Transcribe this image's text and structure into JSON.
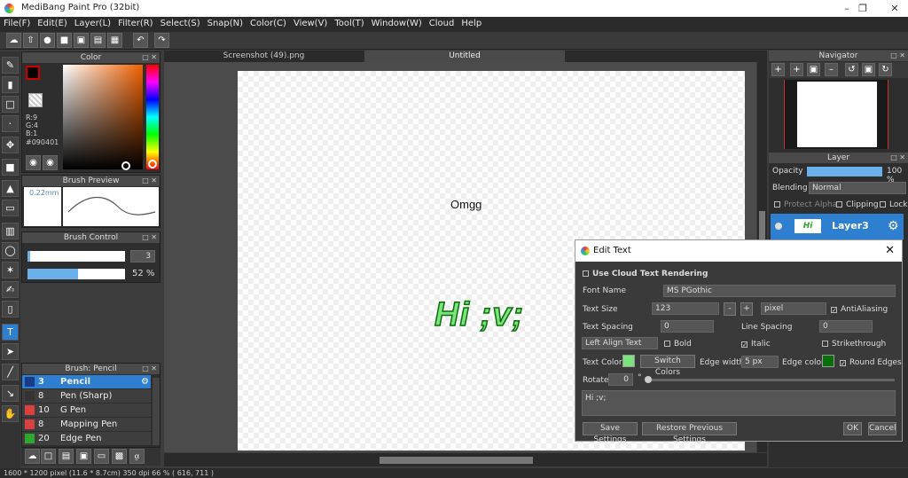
{
  "window": {
    "title": "MediBang Paint Pro (32bit)"
  },
  "menu": [
    "File(F)",
    "Edit(E)",
    "Layer(L)",
    "Filter(R)",
    "Select(S)",
    "Snap(N)",
    "Color(C)",
    "View(V)",
    "Tool(T)",
    "Window(W)",
    "Cloud",
    "Help"
  ],
  "color_panel": {
    "title": "Color",
    "r": "R:9",
    "g": "G:4",
    "b": "B:1",
    "hex": "#090401",
    "fg": "#090401"
  },
  "brush_preview": {
    "title": "Brush Preview",
    "size": "0.22mm"
  },
  "brush_control": {
    "title": "Brush Control",
    "size_value": "3",
    "opacity_value": "52 %",
    "size_level": 0.02,
    "opacity_level": 0.52
  },
  "brush_list": {
    "title": "Brush: Pencil",
    "items": [
      {
        "num": "3",
        "label": "Pencil",
        "color": "#1a3a8a",
        "selected": true
      },
      {
        "num": "8",
        "label": "Pen (Sharp)",
        "color": "#333333",
        "selected": false
      },
      {
        "num": "10",
        "label": "G Pen",
        "color": "#d94040",
        "selected": false
      },
      {
        "num": "8",
        "label": "Mapping Pen",
        "color": "#d94040",
        "selected": false
      },
      {
        "num": "20",
        "label": "Edge Pen",
        "color": "#2fa82f",
        "selected": false
      }
    ]
  },
  "tabs": {
    "tab1": "Screenshot (49).png",
    "tab2": "Untitled"
  },
  "canvas": {
    "text1": "Omgg",
    "text2": "Hi ;v;"
  },
  "status": {
    "text": "1600 * 1200 pixel   (11.6 * 8.7cm)   350 dpi   66 %   ( 616, 711 )"
  },
  "navigator": {
    "title": "Navigator"
  },
  "layer_panel": {
    "title": "Layer",
    "opacity_label": "Opacity",
    "opacity_value": "100 %",
    "blending_label": "Blending",
    "blending_value": "Normal",
    "protect_alpha": "Protect Alpha",
    "clipping": "Clipping",
    "lock": "Lock",
    "layer_name": "Layer3"
  },
  "dialog": {
    "title": "Edit Text",
    "cloud_render": "Use Cloud Text Rendering",
    "font_name_label": "Font Name",
    "font_name_value": "MS PGothic",
    "text_size_label": "Text Size",
    "text_size_value": "123",
    "minus": "-",
    "plus": "+",
    "unit": "pixel",
    "antialias": "AntiAliasing",
    "text_spacing_label": "Text Spacing",
    "text_spacing_value": "0",
    "line_spacing_label": "Line Spacing",
    "line_spacing_value": "0",
    "align_value": "Left Align Text",
    "bold": "Bold",
    "italic": "Italic",
    "strikethrough": "Strikethrough",
    "text_color_label": "Text Color",
    "text_color": "#7be37b",
    "switch_colors": "Switch Colors",
    "edge_width_label": "Edge width",
    "edge_width_value": "5 px",
    "edge_color_label": "Edge color",
    "edge_color": "#0a6e0a",
    "round_edges": "Round Edges",
    "rotate_label": "Rotate",
    "rotate_value": "0",
    "degree": "°",
    "text_value": "Hi ;v;",
    "save_settings": "Save Settings",
    "restore_settings": "Restore Previous Settings",
    "ok": "OK",
    "cancel": "Cancel"
  }
}
